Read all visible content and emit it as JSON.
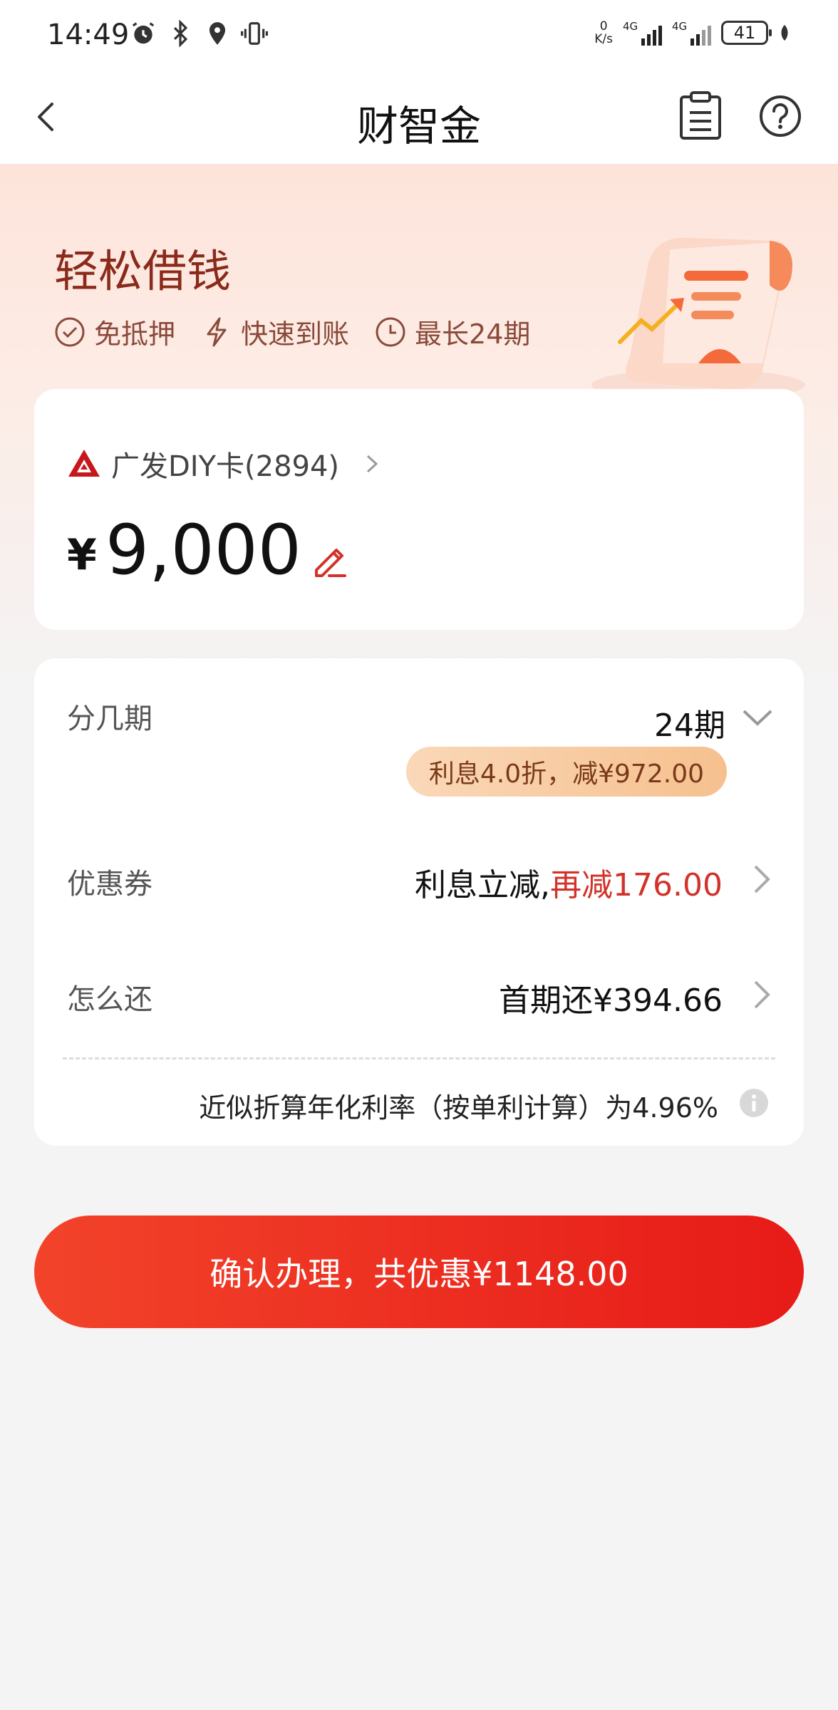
{
  "status_bar": {
    "time": "14:49",
    "net_speed_value": "0",
    "net_speed_unit": "K/s",
    "signal1_label": "4G",
    "signal2_label": "4G",
    "battery": "41"
  },
  "nav": {
    "title": "财智金"
  },
  "hero": {
    "title": "轻松借钱",
    "features": [
      "免抵押",
      "快速到账",
      "最长24期"
    ]
  },
  "amount_card": {
    "bank_name": "广发DIY卡(2894)",
    "currency": "¥",
    "amount": "9,000"
  },
  "options": {
    "term_label": "分几期",
    "term_value": "24期",
    "discount_pill": "利息4.0折，减¥972.00",
    "coupon_label": "优惠券",
    "coupon_value_prefix": "利息立减,",
    "coupon_value_highlight": "再减176.00",
    "repay_label": "怎么还",
    "repay_value": "首期还¥394.66"
  },
  "rate": {
    "text": "近似折算年化利率（按单利计算）为4.96%"
  },
  "confirm": {
    "label": "确认办理，共优惠¥1148.00"
  },
  "colors": {
    "accent_red": "#e71b18",
    "highlight_red": "#d2322a",
    "hero_title": "#8a2a1a"
  }
}
